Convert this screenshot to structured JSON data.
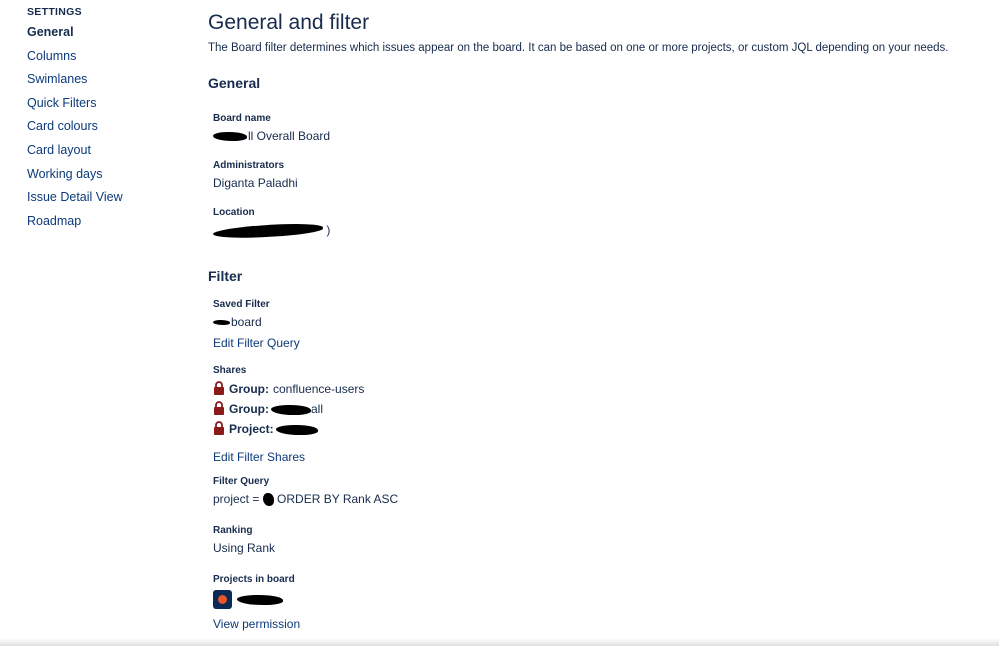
{
  "sidebar": {
    "heading": "SETTINGS",
    "items": [
      {
        "label": "General",
        "active": true
      },
      {
        "label": "Columns"
      },
      {
        "label": "Swimlanes"
      },
      {
        "label": "Quick Filters"
      },
      {
        "label": "Card colours"
      },
      {
        "label": "Card layout"
      },
      {
        "label": "Working days"
      },
      {
        "label": "Issue Detail View"
      },
      {
        "label": "Roadmap"
      }
    ]
  },
  "main": {
    "title": "General and filter",
    "description": "The Board filter determines which issues appear on the board. It can be based on one or more projects, or custom JQL depending on your needs.",
    "general": {
      "heading": "General",
      "board_name_label": "Board name",
      "board_name_value": "ll Overall Board",
      "administrators_label": "Administrators",
      "administrators_value": "Diganta Paladhi",
      "location_label": "Location",
      "location_value": ")"
    },
    "filter": {
      "heading": "Filter",
      "saved_filter_label": "Saved Filter",
      "saved_filter_value": "board",
      "edit_filter_query": "Edit Filter Query",
      "shares_label": "Shares",
      "shares": [
        {
          "type": "Group:",
          "value": "confluence-users"
        },
        {
          "type": "Group:",
          "value": "all"
        },
        {
          "type": "Project:",
          "value": ""
        }
      ],
      "edit_filter_shares": "Edit Filter Shares",
      "filter_query_label": "Filter Query",
      "filter_query_prefix": "project =",
      "filter_query_suffix": "ORDER BY Rank ASC",
      "ranking_label": "Ranking",
      "ranking_value": "Using Rank",
      "projects_label": "Projects in board",
      "view_permission": "View permission"
    }
  },
  "colors": {
    "text": "#172b4d",
    "link": "#0c3a7a",
    "lock": "#8b1a1a"
  }
}
